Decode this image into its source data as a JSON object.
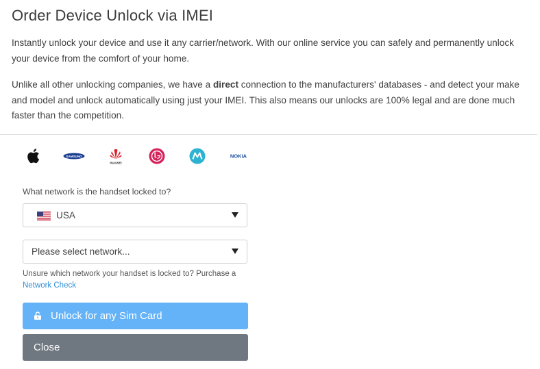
{
  "header": {
    "title": "Order Device Unlock via IMEI"
  },
  "intro": {
    "paragraph1": "Instantly unlock your device and use it any carrier/network. With our online service you can safely and permanently unlock your device from the comfort of your home.",
    "paragraph2_before": "Unlike all other unlocking companies, we have a ",
    "paragraph2_bold": "direct",
    "paragraph2_after": " connection to the manufacturers' databases - and detect your make and model and unlock automatically using just your IMEI. This also means our unlocks are 100% legal and are done much faster than the competition."
  },
  "brands": [
    {
      "name": "Apple",
      "icon": "apple-icon"
    },
    {
      "name": "SAMSUNG",
      "icon": "samsung-icon"
    },
    {
      "name": "HUAWEI",
      "icon": "huawei-icon"
    },
    {
      "name": "LG",
      "icon": "lg-icon"
    },
    {
      "name": "Motorola",
      "icon": "motorola-icon"
    },
    {
      "name": "NOKIA",
      "icon": "nokia-icon"
    }
  ],
  "form": {
    "network_label": "What network is the handset locked to?",
    "country_select": {
      "value": "USA",
      "icon": "us-flag-icon"
    },
    "network_select": {
      "placeholder": "Please select network..."
    },
    "hint_text": "Unsure which network your handset is locked to? Purchase a",
    "hint_link": "Network Check"
  },
  "buttons": {
    "unlock_label": "Unlock for any Sim Card",
    "close_label": "Close"
  },
  "colors": {
    "unlock_button": "#64b2f8",
    "close_button": "#6f7780",
    "link": "#2f8fd6",
    "motorola": "#2db3d1",
    "lg": "#d6225b",
    "huawei": "#d8242b",
    "samsung": "#1c3f92"
  }
}
